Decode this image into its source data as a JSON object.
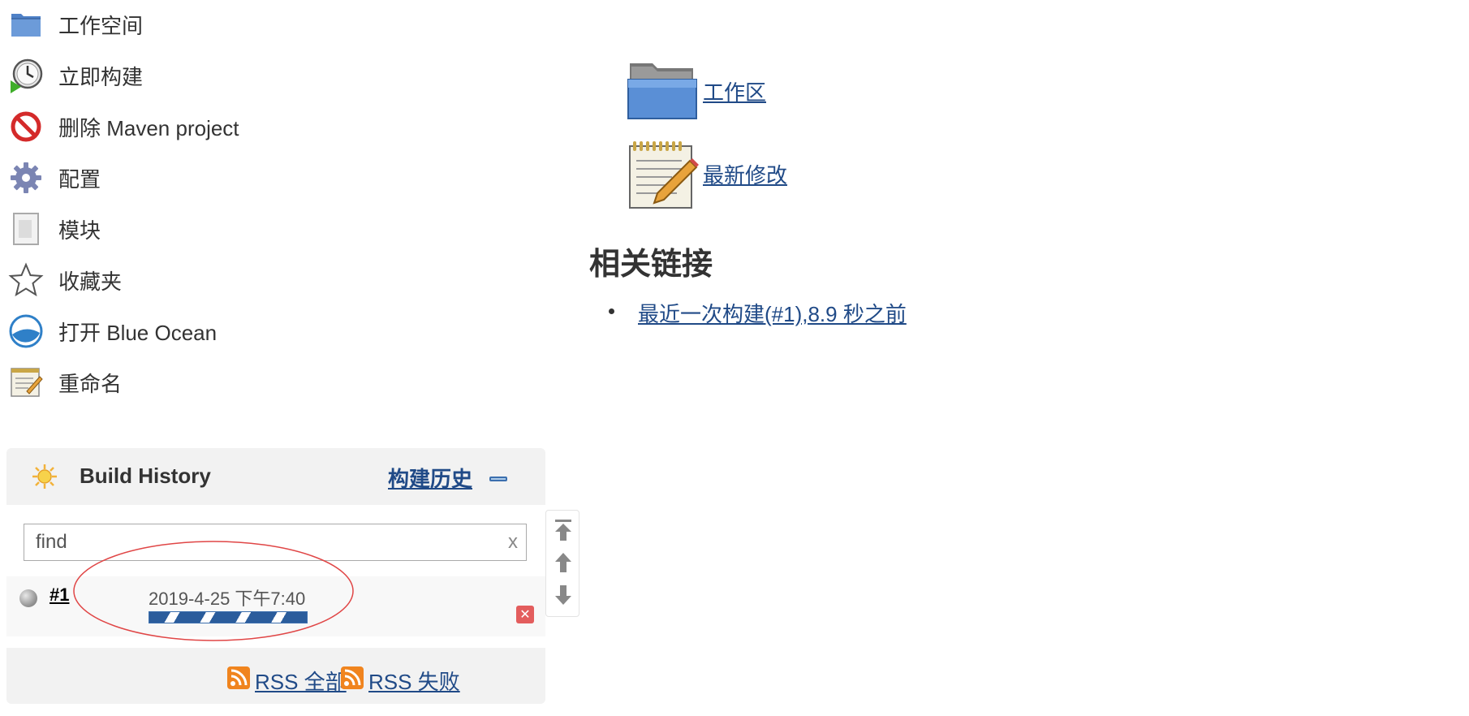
{
  "side_tasks": [
    {
      "label": "工作空间",
      "icon": "folder-icon"
    },
    {
      "label": "立即构建",
      "icon": "build-clock-icon"
    },
    {
      "label": "删除 Maven project",
      "icon": "no-entry-icon"
    },
    {
      "label": "配置",
      "icon": "gear-icon"
    },
    {
      "label": "模块",
      "icon": "document-icon"
    },
    {
      "label": "收藏夹",
      "icon": "star-icon"
    },
    {
      "label": "打开 Blue Ocean",
      "icon": "blue-ocean-icon"
    },
    {
      "label": "重命名",
      "icon": "notepad-pencil-icon"
    }
  ],
  "build_history": {
    "title": "Build History",
    "history_link": "构建历史",
    "search": {
      "value": "find",
      "clear": "x"
    },
    "builds": [
      {
        "number": "#1",
        "date": "2019-4-25 下午7:40",
        "status": "in-progress",
        "progress": "indeterminate"
      }
    ],
    "rss_all": "RSS 全部",
    "rss_failed": "RSS 失败"
  },
  "main": {
    "links": [
      {
        "label": "工作区",
        "icon": "folder-icon"
      },
      {
        "label": "最新修改",
        "icon": "notepad-pencil-icon"
      }
    ],
    "related_heading": "相关链接",
    "related_links": [
      {
        "label": "最近一次构建(#1),8.9 秒之前"
      }
    ]
  },
  "colors": {
    "link": "#204a87",
    "panel_bg": "#f2f2f2",
    "progress": "#2b5d9c",
    "annotation_ellipse": "#e04646"
  }
}
